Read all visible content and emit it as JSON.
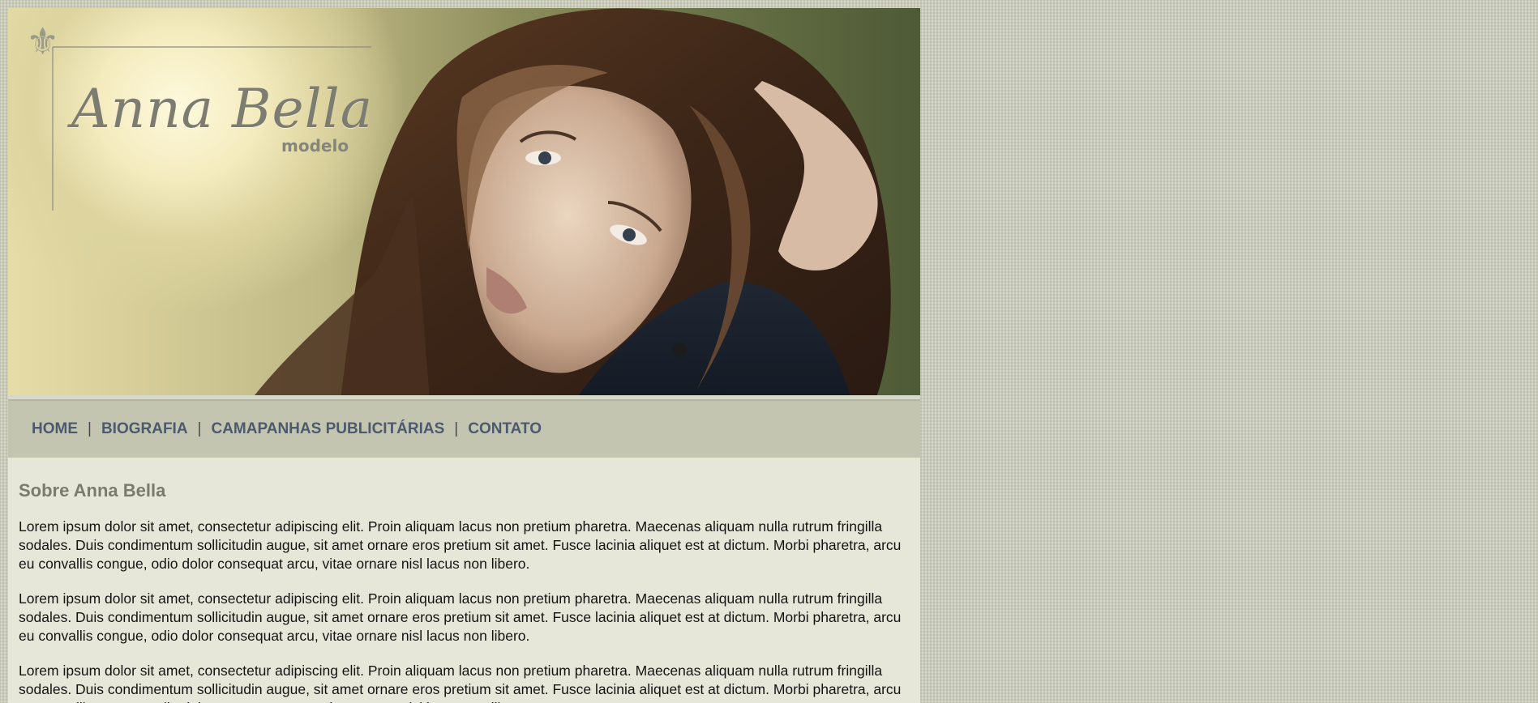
{
  "header": {
    "logo_title": "Anna Bella",
    "logo_subtitle": "modelo"
  },
  "nav": {
    "items": [
      {
        "label": "HOME"
      },
      {
        "label": "BIOGRAFIA"
      },
      {
        "label": "CAMAPANHAS PUBLICITÁRIAS"
      },
      {
        "label": "CONTATO"
      }
    ],
    "separator": "|"
  },
  "main": {
    "heading": "Sobre Anna Bella",
    "paragraphs": [
      "Lorem ipsum dolor sit amet, consectetur adipiscing elit. Proin aliquam lacus non pretium pharetra. Maecenas aliquam nulla rutrum fringilla sodales. Duis condimentum sollicitudin augue, sit amet ornare eros pretium sit amet. Fusce lacinia aliquet est at dictum. Morbi pharetra, arcu eu convallis congue, odio dolor consequat arcu, vitae ornare nisl lacus non libero.",
      "Lorem ipsum dolor sit amet, consectetur adipiscing elit. Proin aliquam lacus non pretium pharetra. Maecenas aliquam nulla rutrum fringilla sodales. Duis condimentum sollicitudin augue, sit amet ornare eros pretium sit amet. Fusce lacinia aliquet est at dictum. Morbi pharetra, arcu eu convallis congue, odio dolor consequat arcu, vitae ornare nisl lacus non libero.",
      "Lorem ipsum dolor sit amet, consectetur adipiscing elit. Proin aliquam lacus non pretium pharetra. Maecenas aliquam nulla rutrum fringilla sodales. Duis condimentum sollicitudin augue, sit amet ornare eros pretium sit amet. Fusce lacinia aliquet est at dictum. Morbi pharetra, arcu eu convallis congue, odio dolor consequat arcu, vitae ornare nisl lacus non libero."
    ]
  },
  "colors": {
    "page_background": "#c9cbba",
    "content_background": "#e6e7d8",
    "nav_background": "#c3c5b0",
    "nav_link": "#4d596c",
    "heading": "#7b7b6c"
  },
  "icons": [
    "fleur-de-lis-icon"
  ]
}
